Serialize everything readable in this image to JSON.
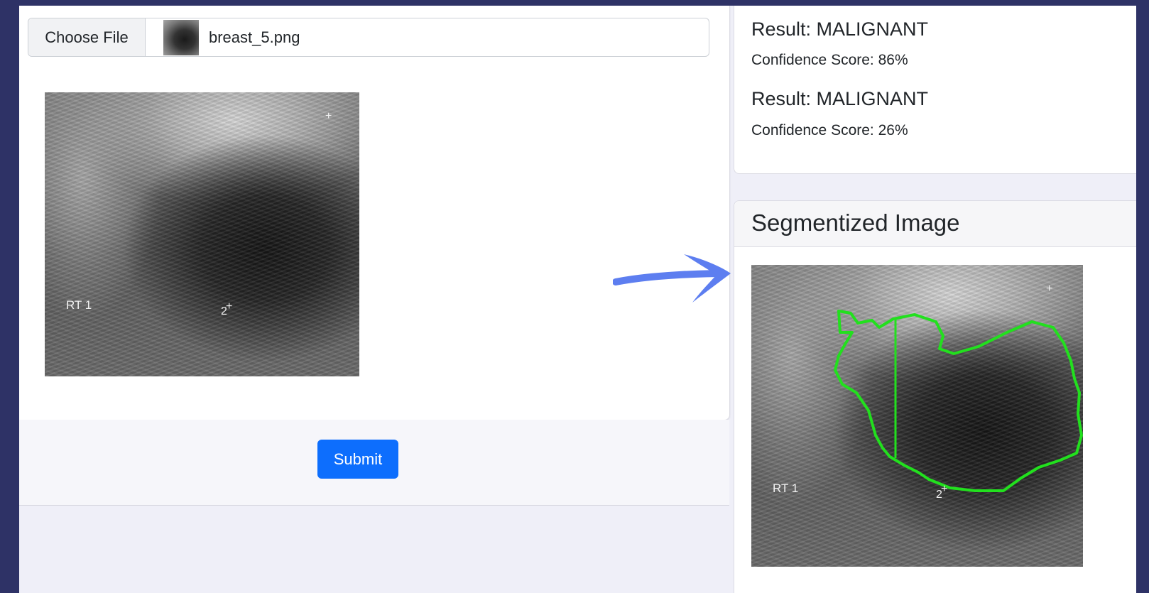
{
  "upload": {
    "choose_label": "Choose File",
    "file_name": "breast_5.png"
  },
  "preview": {
    "label_rt": "RT 1",
    "marker_num": "2",
    "marker_plus": "+"
  },
  "actions": {
    "submit_label": "Submit"
  },
  "results": [
    {
      "title": "Result: MALIGNANT",
      "confidence": "Confidence Score: 86%"
    },
    {
      "title": "Result: MALIGNANT",
      "confidence": "Confidence Score: 26%"
    }
  ],
  "segmentation": {
    "title": "Segmentized Image",
    "label_rt": "RT 1",
    "marker_num": "2",
    "marker_plus": "+",
    "contour_color": "#22e01e"
  },
  "colors": {
    "frame": "#2e3266",
    "page_bg": "#efeff8",
    "submit_bg": "#0d6efd",
    "arrow": "#5d7ef0"
  },
  "icons": {
    "arrow": "right-arrow-icon"
  }
}
